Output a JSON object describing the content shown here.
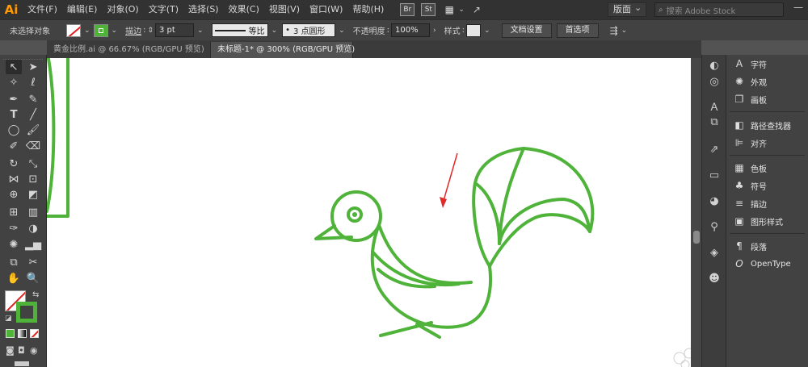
{
  "menubar": {
    "logo": "Ai",
    "items": [
      "文件(F)",
      "编辑(E)",
      "对象(O)",
      "文字(T)",
      "选择(S)",
      "效果(C)",
      "视图(V)",
      "窗口(W)",
      "帮助(H)"
    ],
    "bridge": "Br",
    "stock": "St",
    "workspace": "版面",
    "search_placeholder": "搜索 Adobe Stock"
  },
  "controlbar": {
    "selection_label": "未选择对象",
    "stroke_label": "描边",
    "stroke_weight": "3 pt",
    "stroke_profile": "等比",
    "brush": "3 点圆形",
    "opacity_label": "不透明度",
    "opacity_value": "100%",
    "style_label": "样式",
    "doc_setup": "文档设置",
    "preferences": "首选项",
    "colors": {
      "fill": "none",
      "stroke": "#4fb33a"
    }
  },
  "tabs": [
    {
      "label": "黄金比例.ai @ 66.67% (RGB/GPU 预览)",
      "active": false
    },
    {
      "label": "未标题-1* @ 300% (RGB/GPU 预览)",
      "active": true
    }
  ],
  "panels": {
    "items": [
      {
        "label": "字符",
        "icon": "character-icon"
      },
      {
        "label": "外观",
        "icon": "appearance-icon"
      },
      {
        "label": "画板",
        "icon": "artboards-icon"
      },
      {
        "label": "路径查找器",
        "icon": "pathfinder-icon"
      },
      {
        "label": "对齐",
        "icon": "align-icon"
      },
      {
        "label": "色板",
        "icon": "swatches-icon"
      },
      {
        "label": "符号",
        "icon": "symbols-icon"
      },
      {
        "label": "描边",
        "icon": "stroke-icon"
      },
      {
        "label": "图形样式",
        "icon": "graphic-styles-icon"
      },
      {
        "label": "段落",
        "icon": "paragraph-icon"
      },
      {
        "label": "OpenType",
        "icon": "opentype-icon"
      }
    ]
  },
  "artwork": {
    "stroke_color": "#4fb33a",
    "arrow_color": "#e02a2a"
  }
}
